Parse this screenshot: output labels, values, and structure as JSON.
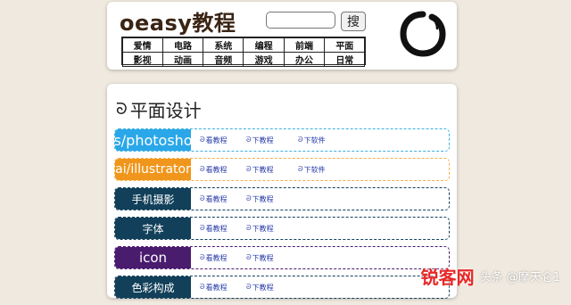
{
  "header": {
    "title": "oeasy教程",
    "search_placeholder": "",
    "search_button": "搜",
    "nav": [
      "爱情",
      "电路",
      "系统",
      "编程",
      "前端",
      "平面",
      "影视",
      "动画",
      "音频",
      "游戏",
      "办公",
      "日常"
    ],
    "logo_icon": "enso-circle-icon"
  },
  "section": {
    "title": "平面设计",
    "title_icon": "swirl-icon"
  },
  "rows": [
    {
      "tag": "ps/photoshop",
      "tag_bg": "#2aa7e8",
      "border": "#3ab0e0",
      "tag_size": "16px",
      "links": [
        "看教程",
        "下教程",
        "下软件"
      ]
    },
    {
      "tag": "ai/illustrator",
      "tag_bg": "#f0961c",
      "border": "#f5b04a",
      "tag_size": "14px",
      "links": [
        "看教程",
        "下教程",
        "下软件"
      ]
    },
    {
      "tag": "手机摄影",
      "tag_bg": "#12405a",
      "border": "#12405a",
      "tag_size": "12px",
      "links": [
        "看教程",
        "下教程"
      ]
    },
    {
      "tag": "字体",
      "tag_bg": "#12405a",
      "border": "#12405a",
      "tag_size": "12px",
      "links": [
        "看教程",
        "下教程"
      ]
    },
    {
      "tag": "icon",
      "tag_bg": "#4a1c6e",
      "border": "#4a1c6e",
      "tag_size": "15px",
      "links": [
        "看教程",
        "下教程"
      ]
    },
    {
      "tag": "色彩构成",
      "tag_bg": "#12405a",
      "border": "#12405a",
      "tag_size": "12px",
      "links": [
        "看教程",
        "下教程"
      ]
    }
  ],
  "link_icon": "spiral-icon",
  "watermark": {
    "prefix": "头条 @摩天仑1",
    "brand": "锐客网"
  }
}
